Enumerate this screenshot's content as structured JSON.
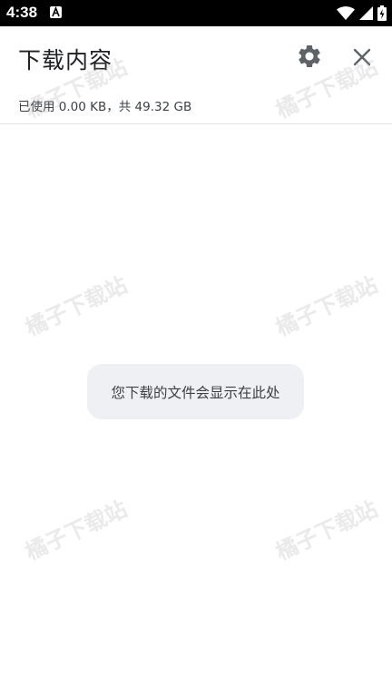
{
  "status_bar": {
    "time": "4:38",
    "icons": [
      "notification-a-icon",
      "wifi-icon",
      "signal-icon",
      "battery-icon"
    ]
  },
  "header": {
    "title": "下载内容",
    "storage_text": "已使用 0.00 KB，共 49.32 GB",
    "actions": [
      "gear-icon",
      "close-icon"
    ]
  },
  "main": {
    "empty_message": "您下载的文件会显示在此处"
  },
  "watermark_text": "橘子下载站",
  "colors": {
    "status_bar_bg": "#000000",
    "background": "#ffffff",
    "icon": "#5f6368",
    "empty_message_bg": "#eff0f4"
  }
}
